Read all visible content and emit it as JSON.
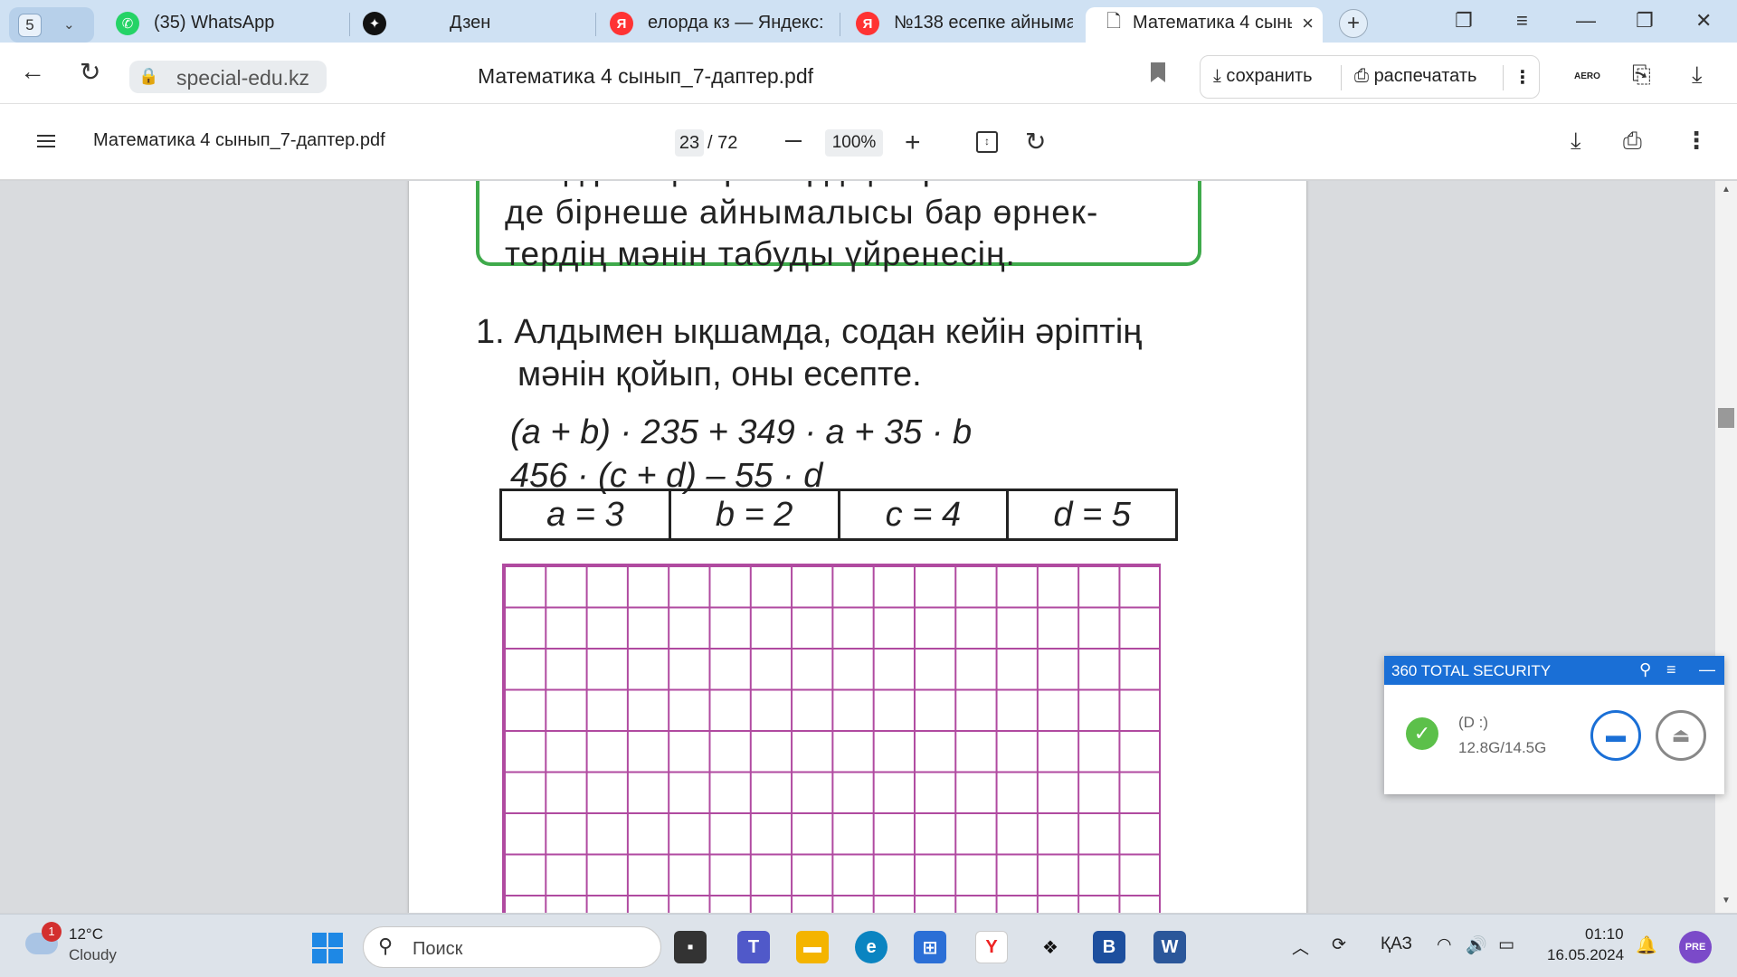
{
  "tabs": {
    "count": "5",
    "items": [
      {
        "label": "(35) WhatsApp",
        "icon": "whatsapp-icon"
      },
      {
        "label": "Дзен",
        "icon": "dzen-icon"
      },
      {
        "label": "елорда кз — Яндекс: н",
        "icon": "yandex-icon"
      },
      {
        "label": "№138 есепке айныма",
        "icon": "yandex-icon"
      },
      {
        "label": "Математика 4 сыны",
        "icon": "document-icon",
        "active": true
      }
    ]
  },
  "address": {
    "host": "special-edu.kz",
    "title": "Математика 4 сынып_7-даптер.pdf",
    "save_label": "сохранить",
    "print_label": "распечатать",
    "aero_label": "AERO"
  },
  "pdf": {
    "title": "Математика 4 сынып_7-даптер.pdf",
    "page": "23",
    "total": "/ 72",
    "zoom": "100%"
  },
  "content": {
    "goal_lines": [
      "лендіресің. Әріптердің берілген мәнін-",
      "де  бірнеше  айнымалысы  бар  өрнек-",
      "тердің мәнін табуды үйренесің."
    ],
    "task_line1": "1. Алдымен  ықшамда,  содан  кейін  әріптің",
    "task_line2": "мәнін қойып, оны есепте.",
    "expr1": "(a + b) · 235 + 349 · a + 35 · b",
    "expr2": "456 · (c + d) – 55 · d",
    "values": [
      "a = 3",
      "b = 2",
      "c = 4",
      "d = 5"
    ]
  },
  "security": {
    "title": "360 TOTAL SECURITY",
    "drive": "(D :)",
    "size": "12.8G/14.5G"
  },
  "taskbar": {
    "weather_badge": "1",
    "temperature": "12°C",
    "condition": "Cloudy",
    "search_placeholder": "Поиск",
    "lang": "ҚАЗ",
    "time": "01:10",
    "date": "16.05.2024"
  }
}
